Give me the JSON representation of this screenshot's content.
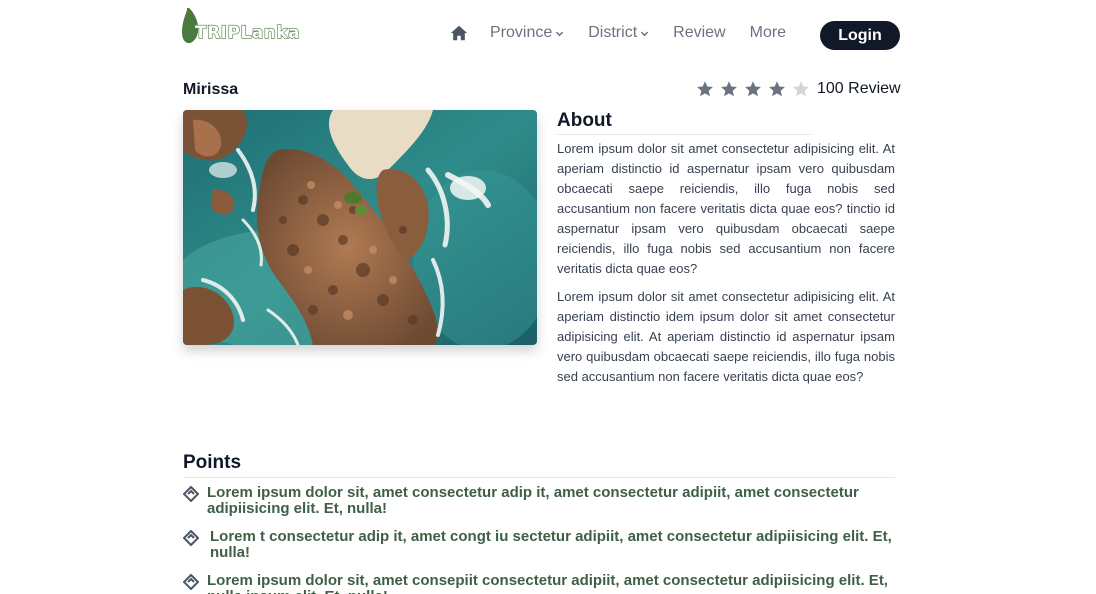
{
  "brand": {
    "logo_text": "TRIPLanka"
  },
  "nav": {
    "home_icon": "home-icon",
    "items": [
      {
        "label": "Province",
        "has_dropdown": true
      },
      {
        "label": "District",
        "has_dropdown": true
      },
      {
        "label": "Review",
        "has_dropdown": false
      },
      {
        "label": "More",
        "has_dropdown": false
      }
    ],
    "login_label": "Login"
  },
  "place": {
    "title": "Mirissa",
    "rating": 4,
    "rating_max": 5,
    "review_label": "100 Review",
    "image_description": "aerial-coast-photo"
  },
  "about": {
    "heading": "About",
    "paragraphs": [
      "Lorem ipsum dolor sit amet consectetur adipisicing elit. At aperiam distinctio id aspernatur ipsam vero quibusdam obcaecati saepe reiciendis, illo fuga nobis sed accusantium non facere veritatis dicta quae eos? tinctio id aspernatur ipsam vero quibusdam obcaecati saepe reiciendis, illo fuga nobis sed accusantium non facere veritatis dicta quae eos?",
      "Lorem ipsum dolor sit amet consectetur adipisicing elit. At aperiam distinctio idem ipsum dolor sit amet consectetur adipisicing elit. At aperiam distinctio id aspernatur ipsam vero quibusdam obcaecati saepe reiciendis, illo fuga nobis sed accusantium non facere veritatis dicta quae eos?"
    ]
  },
  "points": {
    "heading": "Points",
    "items": [
      "Lorem ipsum dolor sit, amet consectetur adip it, amet consectetur adipiit, amet consectetur adipiisicing elit. Et, nulla!",
      "Lorem t consectetur adip it, amet congt iu sectetur adipiit, amet consectetur adipiisicing elit. Et, nulla!",
      "Lorem ipsum dolor sit, amet consepiit consectetur adipiit, amet consectetur adipiisicing elit. Et, nulla ipsum elit. Et, nulla!"
    ]
  },
  "colors": {
    "brand_green": "#4a7a3d",
    "point_text": "#3f5f46",
    "login_bg": "#111827",
    "star_filled": "#6b7280",
    "star_empty": "#d1d5db"
  }
}
